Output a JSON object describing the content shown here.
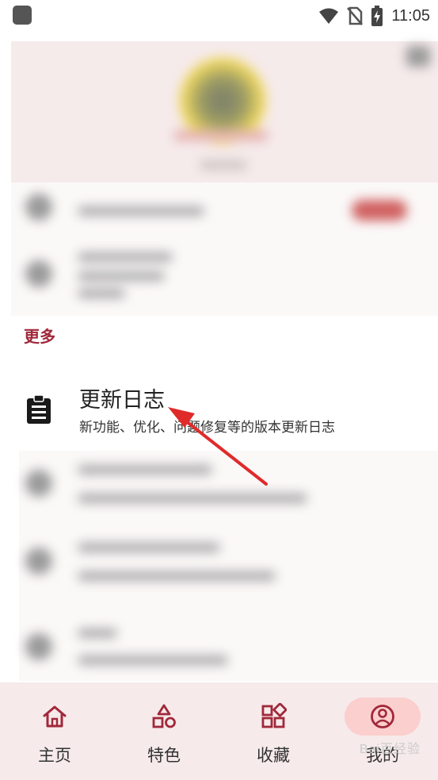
{
  "status_bar": {
    "time": "11:05"
  },
  "more_section": {
    "title": "更多"
  },
  "changelog": {
    "title": "更新日志",
    "description": "新功能、优化、问题修复等的版本更新日志",
    "icon": "clipboard-icon"
  },
  "bottom_nav": {
    "items": [
      {
        "label": "主页",
        "icon": "home-icon"
      },
      {
        "label": "特色",
        "icon": "shapes-icon"
      },
      {
        "label": "收藏",
        "icon": "grid-icon"
      },
      {
        "label": "我的",
        "icon": "account-icon"
      }
    ],
    "active_index": 3
  },
  "watermark": "Bai百经验",
  "colors": {
    "accent": "#a0283a",
    "nav_background": "#f6eaea",
    "active_pill": "#fbcfcd",
    "arrow": "#e02a2a"
  }
}
